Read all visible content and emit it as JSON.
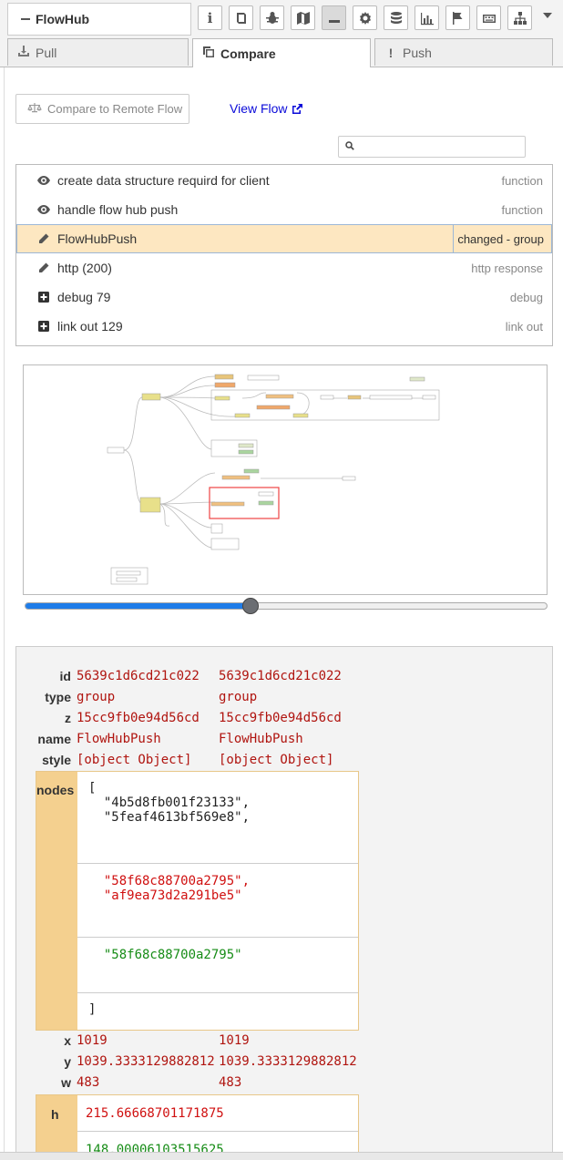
{
  "header": {
    "title": "FlowHub",
    "toolbar_icons": [
      "info-icon",
      "book-icon",
      "bug-icon",
      "map-icon",
      "minus-icon",
      "gear-icon",
      "database-icon",
      "chart-icon",
      "flag-icon",
      "keyboard-icon",
      "sitemap-icon",
      "chevron-down-icon"
    ]
  },
  "tabs": [
    {
      "label": "Pull",
      "icon": "download-icon",
      "active": false
    },
    {
      "label": "Compare",
      "icon": "copy-icon",
      "active": true
    },
    {
      "label": "Push",
      "icon": "exclamation-icon",
      "active": false
    }
  ],
  "compare": {
    "button_label": "Compare to Remote Flow",
    "view_flow_label": "View Flow",
    "search_placeholder": ""
  },
  "changes": [
    {
      "icon": "eye-icon",
      "label": "create data structure requird for client",
      "type": "function",
      "selected": false
    },
    {
      "icon": "eye-icon",
      "label": "handle flow hub push",
      "type": "function",
      "selected": false
    },
    {
      "icon": "pencil-icon",
      "label": "FlowHubPush",
      "type": "changed - group",
      "selected": true
    },
    {
      "icon": "pencil-icon",
      "label": "http (200)",
      "type": "http response",
      "selected": false
    },
    {
      "icon": "plus-square-icon",
      "label": "debug 79",
      "type": "debug",
      "selected": false
    },
    {
      "icon": "plus-square-icon",
      "label": "link out 129",
      "type": "link out",
      "selected": false
    }
  ],
  "slider": {
    "value_fraction": 0.43
  },
  "diff": {
    "props": [
      {
        "name": "id",
        "left": "5639c1d6cd21c022",
        "right": "5639c1d6cd21c022"
      },
      {
        "name": "type",
        "left": "group",
        "right": "group"
      },
      {
        "name": "z",
        "left": "15cc9fb0e94d56cd",
        "right": "15cc9fb0e94d56cd"
      },
      {
        "name": "name",
        "left": "FlowHubPush",
        "right": "FlowHubPush"
      },
      {
        "name": "style",
        "left": "[object Object]",
        "right": "[object Object]"
      }
    ],
    "nodes": {
      "label": "nodes",
      "open": "[",
      "common": "  \"4b5d8fb001f23133\",\n  \"5feaf4613bf569e8\",",
      "removed": "  \"58f68c88700a2795\",\n  \"af9ea73d2a291be5\"",
      "added": "  \"58f68c88700a2795\"",
      "close": "]"
    },
    "props2": [
      {
        "name": "x",
        "left": "1019",
        "right": "1019"
      },
      {
        "name": "y",
        "left": "1039.3333129882812",
        "right": "1039.3333129882812"
      },
      {
        "name": "w",
        "left": "483",
        "right": "483"
      }
    ],
    "h": {
      "label": "h",
      "old": "215.66668701171875",
      "new": "148.00006103515625"
    }
  },
  "colors": {
    "removed": "#d01010",
    "added": "#168c16",
    "value": "#b0140f",
    "selected_row": "#fde7c1",
    "changed_label_bg": "#f4d08f"
  }
}
